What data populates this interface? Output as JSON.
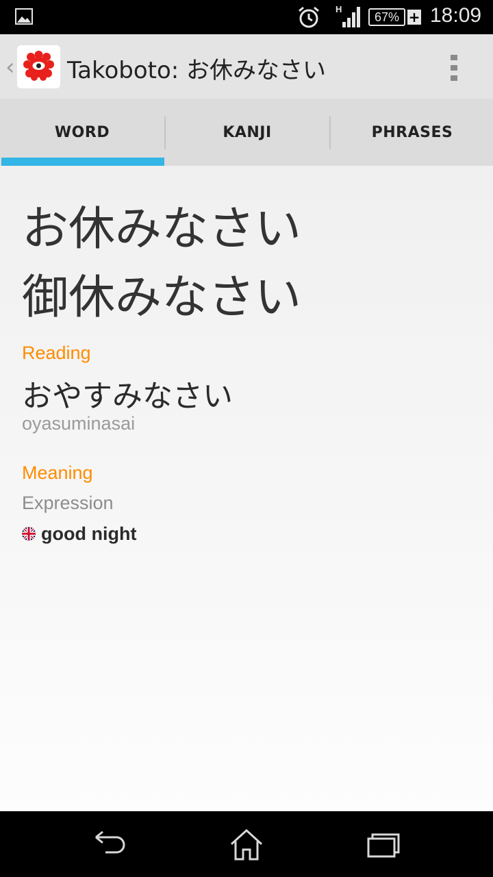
{
  "status_bar": {
    "network": "H",
    "battery": "67%",
    "time": "18:09",
    "icons": [
      "gallery-icon",
      "alarm-icon",
      "signal-icon",
      "battery-icon",
      "charging-icon"
    ]
  },
  "action_bar": {
    "title": "Takoboto: お休みなさい",
    "icons": [
      "up-caret-icon",
      "octopus-logo-icon",
      "overflow-menu-icon"
    ]
  },
  "tabs": [
    {
      "label": "WORD",
      "selected": true
    },
    {
      "label": "KANJI",
      "selected": false
    },
    {
      "label": "PHRASES",
      "selected": false
    }
  ],
  "colors": {
    "accent": "#33b5e5",
    "section_label": "#ff8c00",
    "logo": "#e8211d"
  },
  "entry": {
    "kana_form": "お休みなさい",
    "kanji_form": "御休みなさい",
    "reading_label": "Reading",
    "reading_kana": "おやすみなさい",
    "romaji": "oyasuminasai",
    "meaning_label": "Meaning",
    "part_of_speech": "Expression",
    "gloss_language_icon": "uk-flag-icon",
    "gloss": "good night"
  },
  "nav_bar": {
    "buttons": [
      "back-icon",
      "home-icon",
      "recents-icon"
    ]
  }
}
